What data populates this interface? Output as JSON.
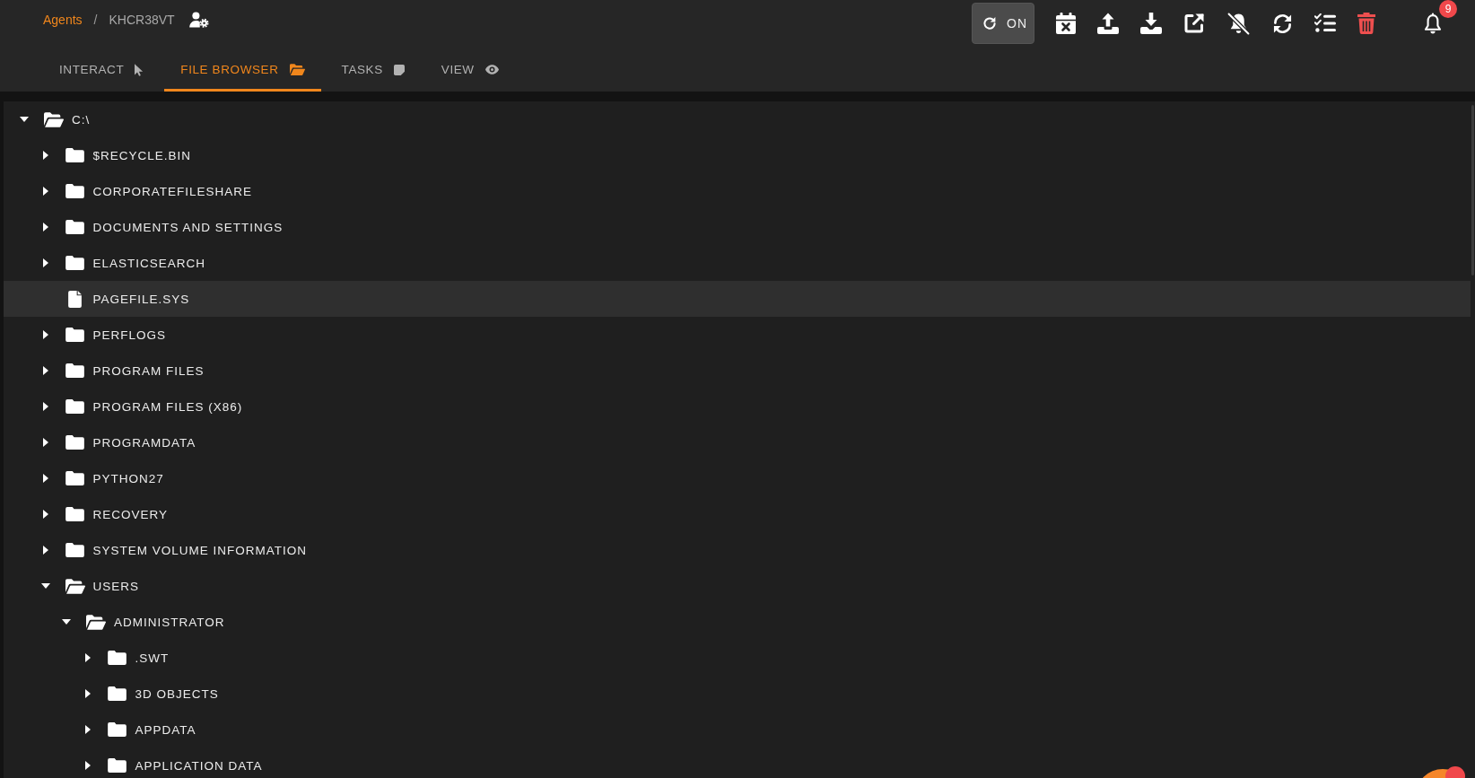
{
  "breadcrumb": [
    {
      "kind": "link",
      "text": "Agents"
    },
    {
      "kind": "separator",
      "text": "/"
    },
    {
      "kind": "current",
      "text": "KHCR38VT"
    }
  ],
  "toolbar": {
    "auto_refresh_label": "ON",
    "notification_count": "9"
  },
  "tabs": [
    {
      "label": "INTERACT",
      "selected": false
    },
    {
      "label": "FILE BROWSER",
      "selected": true
    },
    {
      "label": "TASKS",
      "selected": false
    },
    {
      "label": "VIEW",
      "selected": false
    }
  ],
  "tree": [
    {
      "name": "C:\\",
      "kind": "folder",
      "expanded": true,
      "selected": false,
      "children": [
        {
          "name": "$RECYCLE.BIN",
          "kind": "folder",
          "expanded": false,
          "selected": false
        },
        {
          "name": "CORPORATEFILESHARE",
          "kind": "folder",
          "expanded": false,
          "selected": false
        },
        {
          "name": "DOCUMENTS AND SETTINGS",
          "kind": "folder",
          "expanded": false,
          "selected": false
        },
        {
          "name": "ELASTICSEARCH",
          "kind": "folder",
          "expanded": false,
          "selected": false
        },
        {
          "name": "PAGEFILE.SYS",
          "kind": "file",
          "selected": true
        },
        {
          "name": "PERFLOGS",
          "kind": "folder",
          "expanded": false,
          "selected": false
        },
        {
          "name": "PROGRAM FILES",
          "kind": "folder",
          "expanded": false,
          "selected": false
        },
        {
          "name": "PROGRAM FILES (X86)",
          "kind": "folder",
          "expanded": false,
          "selected": false
        },
        {
          "name": "PROGRAMDATA",
          "kind": "folder",
          "expanded": false,
          "selected": false
        },
        {
          "name": "PYTHON27",
          "kind": "folder",
          "expanded": false,
          "selected": false
        },
        {
          "name": "RECOVERY",
          "kind": "folder",
          "expanded": false,
          "selected": false
        },
        {
          "name": "SYSTEM VOLUME INFORMATION",
          "kind": "folder",
          "expanded": false,
          "selected": false
        },
        {
          "name": "USERS",
          "kind": "folder",
          "expanded": true,
          "selected": false,
          "children": [
            {
              "name": "ADMINISTRATOR",
              "kind": "folder",
              "expanded": true,
              "selected": false,
              "children": [
                {
                  "name": ".SWT",
                  "kind": "folder",
                  "expanded": false,
                  "selected": false
                },
                {
                  "name": "3D OBJECTS",
                  "kind": "folder",
                  "expanded": false,
                  "selected": false
                },
                {
                  "name": "APPDATA",
                  "kind": "folder",
                  "expanded": false,
                  "selected": false
                },
                {
                  "name": "APPLICATION DATA",
                  "kind": "folder",
                  "expanded": false,
                  "selected": false
                }
              ]
            }
          ]
        }
      ]
    }
  ]
}
